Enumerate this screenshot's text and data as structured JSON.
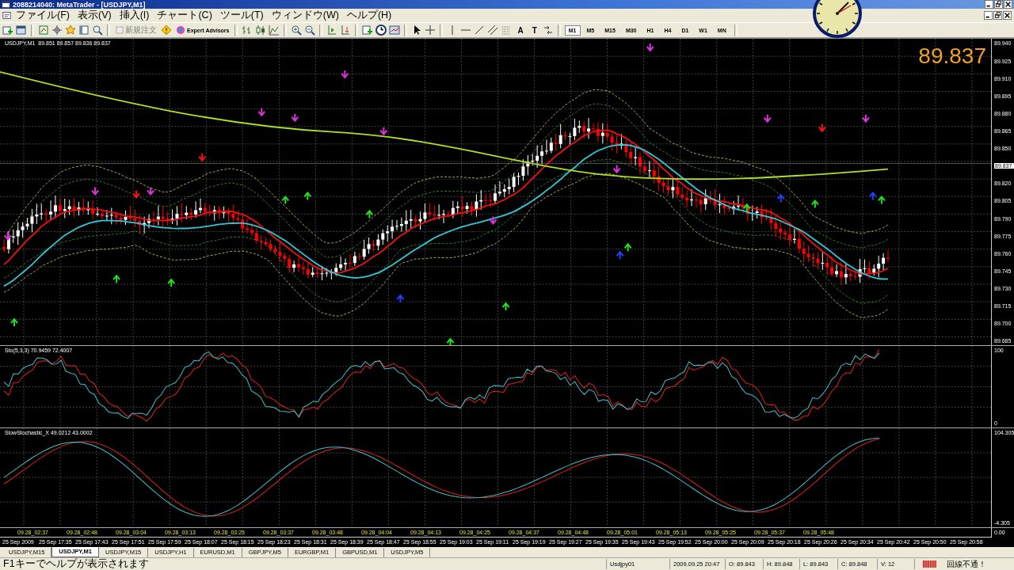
{
  "window": {
    "title": "2088214040: MetaTrader - [USDJPY,M1]"
  },
  "menu": [
    "ファイル(F)",
    "表示(V)",
    "挿入(I)",
    "チャート(C)",
    "ツール(T)",
    "ウィンドウ(W)",
    "ヘルプ(H)"
  ],
  "toolbar": {
    "buttons": [
      {
        "label": "新規注文",
        "disabled": true
      },
      {
        "label": "Expert Advisors",
        "disabled": false
      }
    ],
    "text_tools": [
      "A",
      "T"
    ],
    "timeframes": [
      {
        "label": "M1",
        "selected": true
      },
      {
        "label": "M5",
        "selected": false
      },
      {
        "label": "M15",
        "selected": false
      },
      {
        "label": "M30",
        "selected": false
      },
      {
        "label": "H1",
        "selected": false
      },
      {
        "label": "H4",
        "selected": false
      },
      {
        "label": "D1",
        "selected": false
      },
      {
        "label": "W1",
        "selected": false
      },
      {
        "label": "MN",
        "selected": false
      }
    ]
  },
  "chart": {
    "header": "USDJPY,M1  89.851 89.857 89.836 89.837",
    "last_price": "89.837",
    "price_axis": [
      {
        "label": "89.940",
        "kind": "tick"
      },
      {
        "label": "89.925",
        "kind": "tick"
      },
      {
        "label": "89.910",
        "kind": "tick"
      },
      {
        "label": "89.895",
        "kind": "tick"
      },
      {
        "label": "89.880",
        "kind": "tick"
      },
      {
        "label": "89.865",
        "kind": "tick"
      },
      {
        "label": "89.850",
        "kind": "tick"
      },
      {
        "label": "89.837",
        "kind": "current"
      },
      {
        "label": "89.820",
        "kind": "tick"
      },
      {
        "label": "89.805",
        "kind": "tick"
      },
      {
        "label": "89.790",
        "kind": "tick"
      },
      {
        "label": "89.775",
        "kind": "tick"
      },
      {
        "label": "89.760",
        "kind": "tick"
      },
      {
        "label": "89.745",
        "kind": "tick"
      },
      {
        "label": "89.730",
        "kind": "tick"
      },
      {
        "label": "89.715",
        "kind": "tick"
      },
      {
        "label": "89.700",
        "kind": "tick"
      },
      {
        "label": "89.685",
        "kind": "tick"
      }
    ],
    "indicators": [
      {
        "label": "Sto(5,3,3) 70.9459 72.4007",
        "axis": [
          "100",
          "0"
        ]
      },
      {
        "label": "SlowStochastic_X 49.0212 43.0002",
        "axis": [
          "104.305",
          "-4.305"
        ]
      }
    ],
    "session_axis": {
      "labels": [
        "09.28_02:37",
        "09.28_02:48",
        "09.28_03:04",
        "09.28_03:13",
        "09.28_03:25",
        "09.28_03:37",
        "09.28_03:48",
        "09.28_04:04",
        "09.28_04:13",
        "09.28_04:25",
        "09.28_04:37",
        "09.28_04:48",
        "09.28_05:01",
        "09.28_05:13",
        "09.28_05:25",
        "09.28_05:37",
        "09.28_05:48"
      ],
      "axis": "0.00"
    },
    "time_axis": [
      "25 Sep 2009",
      "25 Sep 17:35",
      "25 Sep 17:43",
      "25 Sep 17:51",
      "25 Sep 17:59",
      "25 Sep 18:07",
      "25 Sep 18:15",
      "25 Sep 18:23",
      "25 Sep 18:31",
      "25 Sep 18:39",
      "25 Sep 18:47",
      "25 Sep 18:55",
      "25 Sep 19:03",
      "25 Sep 19:11",
      "25 Sep 19:19",
      "25 Sep 19:27",
      "25 Sep 19:35",
      "25 Sep 19:43",
      "25 Sep 19:52",
      "25 Sep 20:00",
      "25 Sep 20:09",
      "25 Sep 20:18",
      "25 Sep 20:26",
      "25 Sep 20:34",
      "25 Sep 20:42",
      "25 Sep 20:50",
      "25 Sep 20:58"
    ]
  },
  "tabs": [
    {
      "label": "USDJPY,M15",
      "selected": false
    },
    {
      "label": "USDJPY,M1",
      "selected": true
    },
    {
      "label": "USDJPY,M15",
      "selected": false
    },
    {
      "label": "USDJPY,H1",
      "selected": false
    },
    {
      "label": "EURUSD,M1",
      "selected": false
    },
    {
      "label": "GBPJPY,M5",
      "selected": false
    },
    {
      "label": "EURGBP,M1",
      "selected": false
    },
    {
      "label": "GBPUSD,M1",
      "selected": false
    },
    {
      "label": "USDJPY,M5",
      "selected": false
    }
  ],
  "status_bar": {
    "help": "F1キーでヘルプが表示されます",
    "profile": "Usdjpy01",
    "time": "2009.09.25 20:47",
    "open": "O: 89.843",
    "high": "H: 89.848",
    "low": "L: 89.843",
    "close": "C: 89.848",
    "volume": "V: 12",
    "connection": "回線不通！"
  }
}
